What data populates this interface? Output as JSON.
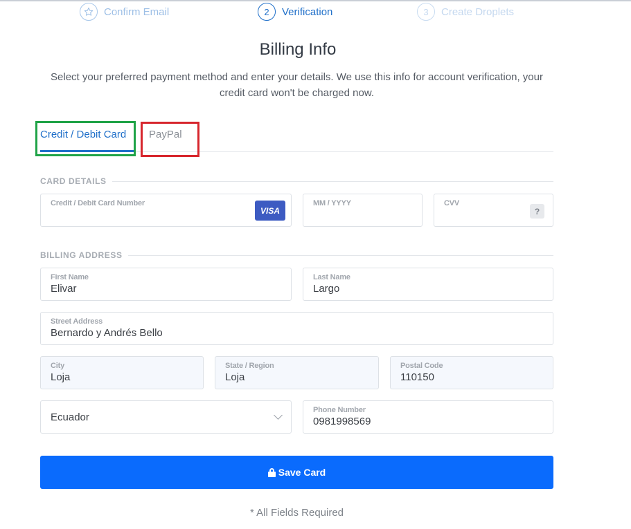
{
  "stepper": {
    "steps": [
      {
        "number": "",
        "label": "Confirm Email",
        "icon": "star-icon"
      },
      {
        "number": "2",
        "label": "Verification"
      },
      {
        "number": "3",
        "label": "Create Droplets"
      }
    ]
  },
  "page": {
    "title": "Billing Info",
    "subtitle": "Select your preferred payment method and enter your details. We use this info for account verification, your credit card won't be charged now."
  },
  "tabs": [
    {
      "label": "Credit / Debit Card",
      "active": true
    },
    {
      "label": "PayPal",
      "active": false
    }
  ],
  "card_details": {
    "heading": "CARD DETAILS",
    "number_label": "Credit / Debit Card Number",
    "number_value": "",
    "brand": "VISA",
    "expiry_label": "MM / YYYY",
    "expiry_value": "",
    "cvv_label": "CVV",
    "cvv_value": "",
    "cvv_help": "?"
  },
  "billing_address": {
    "heading": "BILLING ADDRESS",
    "first_name_label": "First Name",
    "first_name": "Elivar",
    "last_name_label": "Last Name",
    "last_name": "Largo",
    "street_label": "Street Address",
    "street": "Bernardo y Andrés Bello",
    "city_label": "City",
    "city": "Loja",
    "state_label": "State / Region",
    "state": "Loja",
    "postal_label": "Postal Code",
    "postal": "110150",
    "country": "Ecuador",
    "phone_label": "Phone Number",
    "phone": "0981998569"
  },
  "actions": {
    "save_label": "Save Card",
    "required_note": "* All Fields Required"
  },
  "colors": {
    "accent": "#1f6fc9",
    "button": "#0a6bfd",
    "highlight_green": "#1fa347",
    "highlight_red": "#d7262d"
  }
}
